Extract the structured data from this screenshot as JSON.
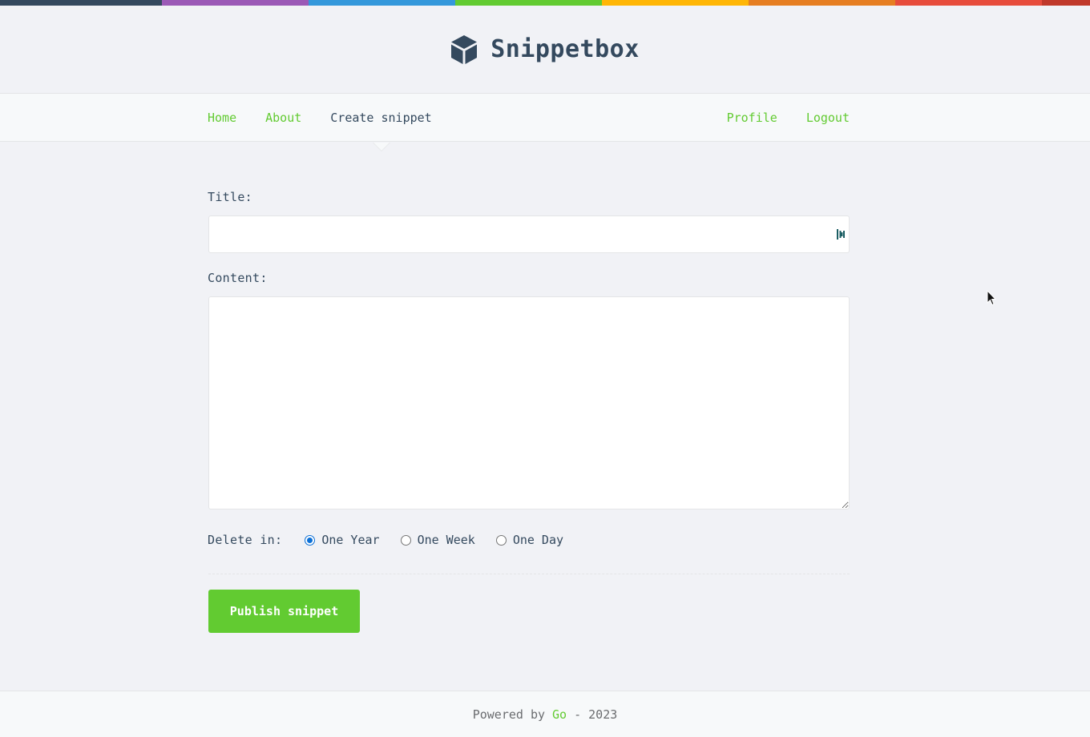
{
  "colors": {
    "accent": "#62cb31",
    "text": "#34495e",
    "background": "#f1f2f6",
    "stripe": [
      "#34495e",
      "#9b59b6",
      "#3498db",
      "#62cb31",
      "#ffb606",
      "#e67e22",
      "#e74c3c",
      "#c0392b"
    ]
  },
  "brand": {
    "title": "Snippetbox",
    "icon": "cube-icon"
  },
  "nav": {
    "home": "Home",
    "about": "About",
    "create": "Create snippet",
    "profile": "Profile",
    "logout": "Logout"
  },
  "form": {
    "title_label": "Title:",
    "title_value": "",
    "content_label": "Content:",
    "content_value": "",
    "delete_label": "Delete in:",
    "expires_options": [
      {
        "label": "One Year",
        "checked": true
      },
      {
        "label": "One Week",
        "checked": false
      },
      {
        "label": "One Day",
        "checked": false
      }
    ],
    "submit_label": "Publish snippet"
  },
  "footer": {
    "prefix": "Powered by",
    "link": "Go",
    "suffix": "- 2023"
  }
}
